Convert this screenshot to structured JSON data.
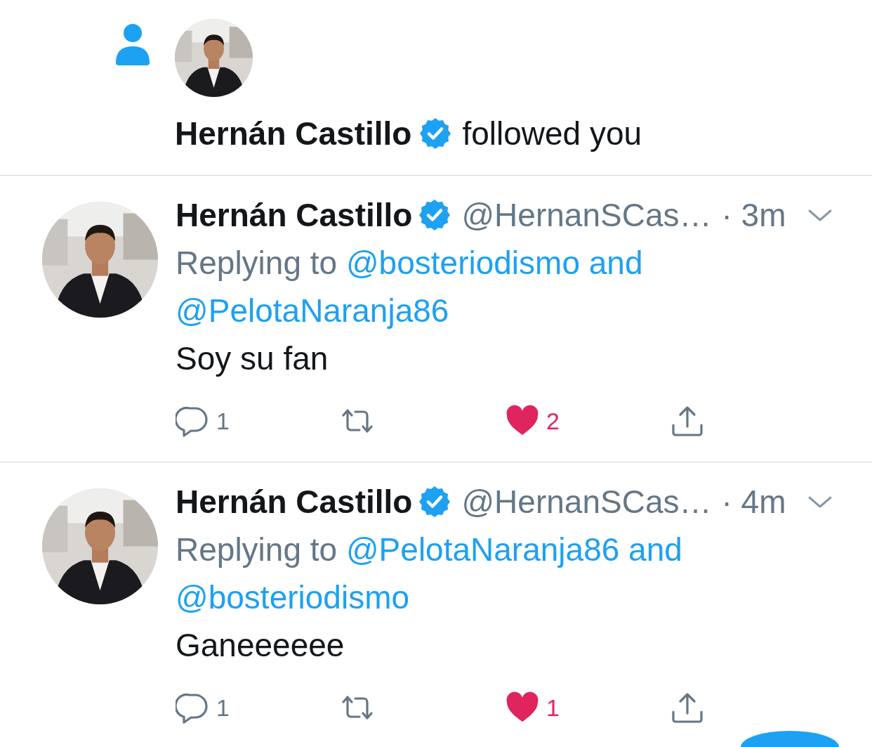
{
  "notification": {
    "user": "Hernán Castillo",
    "verified": true,
    "action": "followed you"
  },
  "tweets": [
    {
      "name": "Hernán Castillo",
      "verified": true,
      "handle": "@HernanSCas…",
      "time": "· 3m",
      "replying_prefix": "Replying to",
      "reply_links": [
        "@bosteriodismo and",
        "@PelotaNaranja86"
      ],
      "text": "Soy su fan",
      "replies": "1",
      "likes": "2",
      "liked": true
    },
    {
      "name": "Hernán Castillo",
      "verified": true,
      "handle": "@HernanSCas…",
      "time": "· 4m",
      "replying_prefix": "Replying to",
      "reply_links": [
        "@PelotaNaranja86 and",
        "@bosteriodismo"
      ],
      "text": "Ganeeeeee",
      "replies": "1",
      "likes": "1",
      "liked": true
    }
  ]
}
